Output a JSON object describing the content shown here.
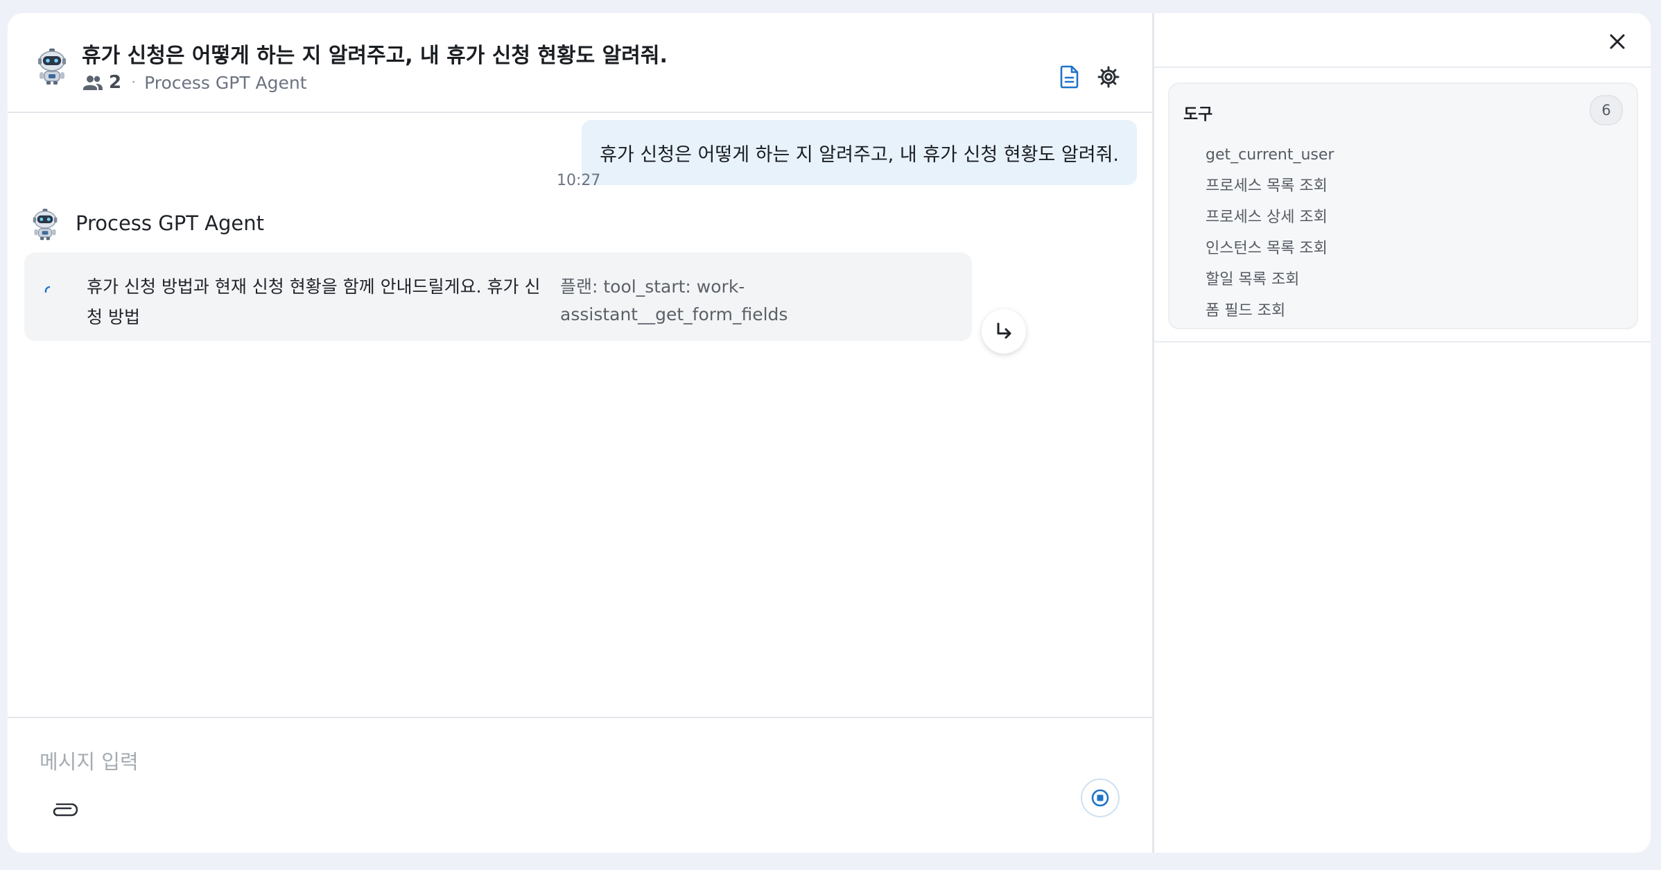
{
  "header": {
    "title": "휴가 신청은 어떻게 하는 지 알려주고, 내 휴가 신청 현황도 알려줘.",
    "participant_count": "2",
    "separator": "·",
    "agent_name": "Process GPT Agent"
  },
  "messages": {
    "user": {
      "text": "휴가 신청은 어떻게 하는 지 알려주고, 내 휴가 신청 현황도 알려줘.",
      "time": "10:27"
    },
    "agent": {
      "name": "Process GPT Agent",
      "text": "휴가 신청 방법과 현재 신청 현황을 함께 안내드릴게요. 휴가 신청 방법",
      "plan": "플랜: tool_start: work-assistant__get_form_fields"
    }
  },
  "composer": {
    "placeholder": "메시지 입력"
  },
  "sidebar": {
    "tools_title": "도구",
    "tools_count": "6",
    "tools": [
      "get_current_user",
      "프로세스 목록 조회",
      "프로세스 상세 조회",
      "인스턴스 목록 조회",
      "할일 목록 조회",
      "폼 필드 조회"
    ]
  },
  "colors": {
    "accent": "#1e73c8",
    "user_bubble": "#e8f2fb",
    "agent_bubble": "#f3f4f6",
    "page_background": "#eef2f8"
  },
  "icons": [
    "robot-avatar-icon",
    "people-icon",
    "document-icon",
    "gear-icon",
    "reply-arrow-icon",
    "paperclip-icon",
    "stop-icon",
    "close-icon",
    "spinner-icon"
  ]
}
